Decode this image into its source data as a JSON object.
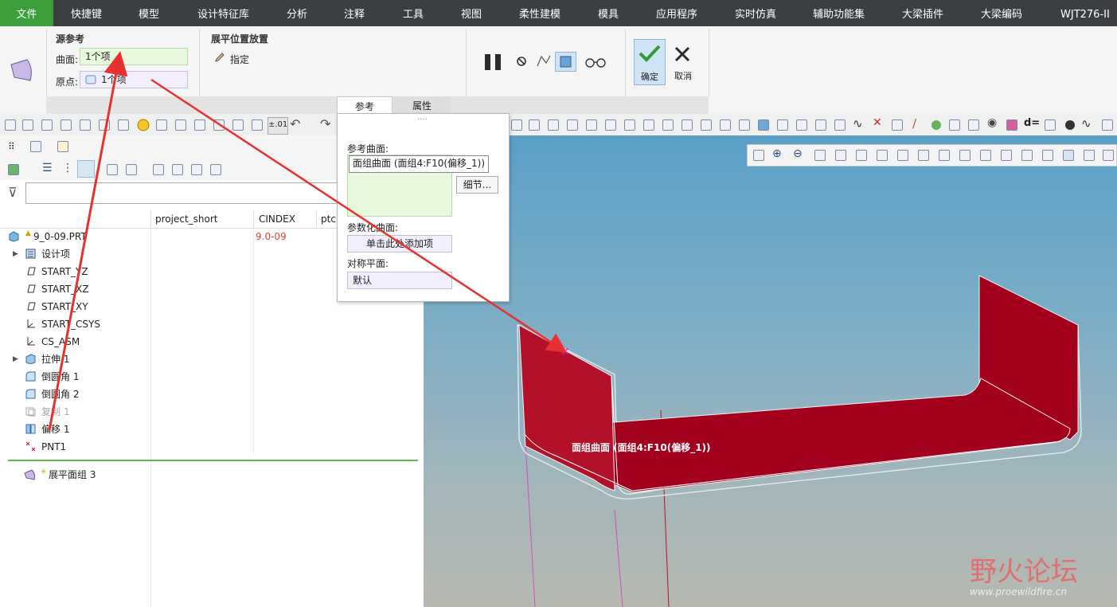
{
  "menu": {
    "file": "文件",
    "shortcuts": "快捷键",
    "model": "模型",
    "design_lib": "设计特征库",
    "analysis": "分析",
    "annotate": "注释",
    "tools": "工具",
    "view": "视图",
    "flexible": "柔性建模",
    "mold": "模具",
    "apps": "应用程序",
    "sim": "实时仿真",
    "aux": "辅助功能集",
    "beam_plugin": "大梁插件",
    "beam_code": "大梁编码",
    "wjt": "WJT276-II"
  },
  "ribbon": {
    "source_ref_title": "源参考",
    "surface_label": "曲面:",
    "surface_value": "1个项",
    "origin_label": "原点:",
    "origin_value": "1个项",
    "placement_title": "展平位置放置",
    "specify_label": "指定",
    "ok_label": "确定",
    "cancel_label": "取消",
    "tab_ref": "参考",
    "tab_props": "属性"
  },
  "toolbar": {
    "precision": "±.01"
  },
  "popup": {
    "ref_surface_label": "参考曲面:",
    "ref_surface_value": "面组曲面 (面组4:F10(偏移_1))",
    "details_button": "细节...",
    "param_surface_label": "参数化曲面:",
    "param_surface_value": "单击此处添加项",
    "sym_plane_label": "对称平面:",
    "sym_plane_value": "默认"
  },
  "tree": {
    "columns": [
      "project_short",
      "CINDEX",
      "ptc"
    ],
    "root": {
      "label": "9_0-09.PRT",
      "cindex": "9.0-09"
    },
    "items": [
      {
        "label": "设计项",
        "icon": "layer-icon"
      },
      {
        "label": "START_YZ",
        "icon": "datum-plane-icon"
      },
      {
        "label": "START_XZ",
        "icon": "datum-plane-icon"
      },
      {
        "label": "START_XY",
        "icon": "datum-plane-icon"
      },
      {
        "label": "START_CSYS",
        "icon": "csys-icon"
      },
      {
        "label": "CS_ASM",
        "icon": "csys-icon"
      },
      {
        "label": "拉伸 1",
        "icon": "extrude-icon"
      },
      {
        "label": "倒圆角 1",
        "icon": "round-icon"
      },
      {
        "label": "倒圆角 2",
        "icon": "round-icon"
      },
      {
        "label": "复制 1",
        "icon": "copy-icon"
      },
      {
        "label": "偏移 1",
        "icon": "offset-icon"
      },
      {
        "label": "PNT1",
        "icon": "point-icon"
      }
    ],
    "flatten": "展平面组 3"
  },
  "viewport": {
    "annotation": "面组曲面 (面组4:F10(偏移_1))"
  },
  "watermark": {
    "name": "野火论坛",
    "url": "www.proewildfire.cn"
  },
  "colors": {
    "menu_bg": "#3b3f44",
    "file_tab": "#3c9f3c",
    "model_red": "#b0102a",
    "arrow": "#e8312f"
  }
}
